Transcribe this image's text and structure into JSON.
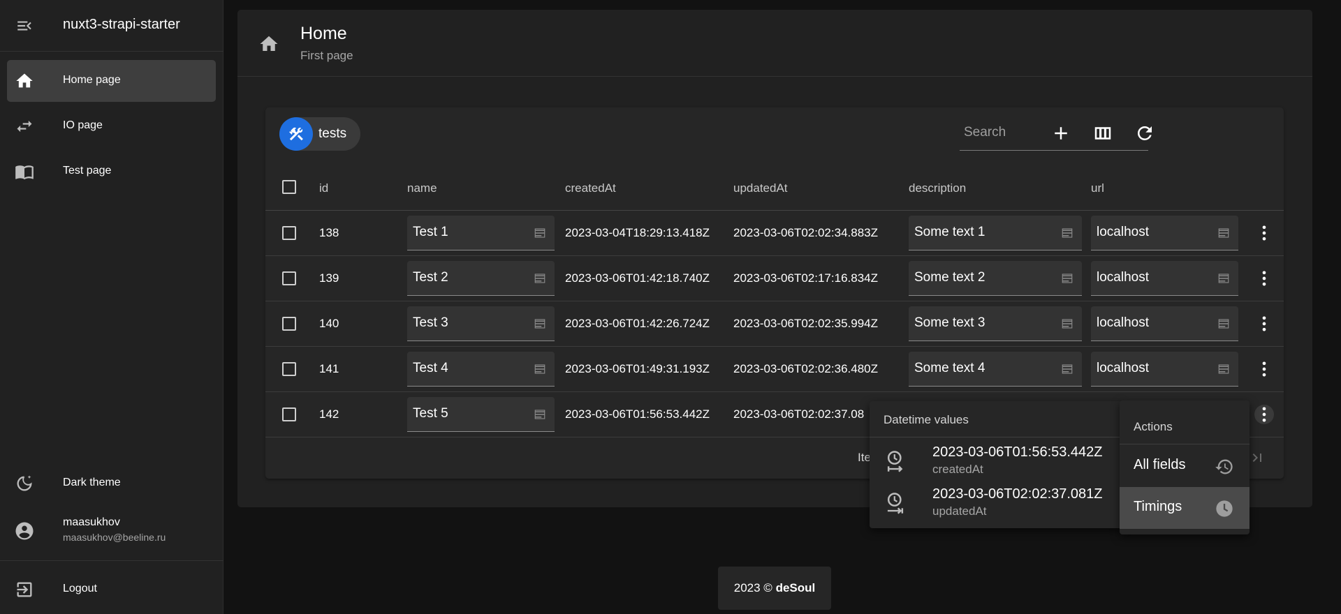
{
  "app": {
    "title": "nuxt3-strapi-starter"
  },
  "sidebar": {
    "items": [
      {
        "label": "Home page",
        "icon": "home-icon"
      },
      {
        "label": "IO page",
        "icon": "swap-icon"
      },
      {
        "label": "Test page",
        "icon": "book-icon"
      }
    ],
    "theme_label": "Dark theme",
    "user": {
      "name": "maasukhov",
      "email": "maasukhov@beeline.ru"
    },
    "logout_label": "Logout"
  },
  "page": {
    "title": "Home",
    "subtitle": "First page"
  },
  "table": {
    "chip_label": "tests",
    "search_placeholder": "Search",
    "columns": [
      "id",
      "name",
      "createdAt",
      "updatedAt",
      "description",
      "url"
    ],
    "rows": [
      {
        "id": "138",
        "name": "Test 1",
        "createdAt": "2023-03-04T18:29:13.418Z",
        "updatedAt": "2023-03-06T02:02:34.883Z",
        "description": "Some text 1",
        "url": "localhost"
      },
      {
        "id": "139",
        "name": "Test 2",
        "createdAt": "2023-03-06T01:42:18.740Z",
        "updatedAt": "2023-03-06T02:17:16.834Z",
        "description": "Some text 2",
        "url": "localhost"
      },
      {
        "id": "140",
        "name": "Test 3",
        "createdAt": "2023-03-06T01:42:26.724Z",
        "updatedAt": "2023-03-06T02:02:35.994Z",
        "description": "Some text 3",
        "url": "localhost"
      },
      {
        "id": "141",
        "name": "Test 4",
        "createdAt": "2023-03-06T01:49:31.193Z",
        "updatedAt": "2023-03-06T02:02:36.480Z",
        "description": "Some text 4",
        "url": "localhost"
      },
      {
        "id": "142",
        "name": "Test 5",
        "createdAt": "2023-03-06T01:56:53.442Z",
        "updatedAt": "2023-03-06T02:02:37.08",
        "description": "",
        "url": ""
      }
    ],
    "pagination_fragment": "Ite"
  },
  "datetime_menu": {
    "header": "Datetime values",
    "items": [
      {
        "value": "2023-03-06T01:56:53.442Z",
        "key": "createdAt"
      },
      {
        "value": "2023-03-06T02:02:37.081Z",
        "key": "updatedAt"
      }
    ]
  },
  "actions_menu": {
    "header": "Actions",
    "items": [
      {
        "label": "All fields",
        "icon": "history-icon"
      },
      {
        "label": "Timings",
        "icon": "clock-icon",
        "active": true
      }
    ]
  },
  "footer": {
    "year": "2023 ©",
    "brand": "deSoul"
  },
  "colors": {
    "accent": "#1e6ee0",
    "background": "#121212",
    "surface": "#212121"
  }
}
